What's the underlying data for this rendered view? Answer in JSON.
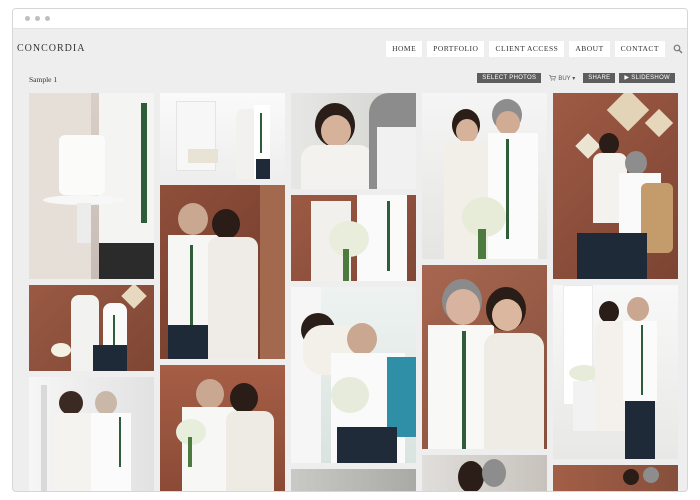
{
  "site": {
    "logo": "CONCORDIA"
  },
  "nav": {
    "items": [
      "HOME",
      "PORTFOLIO",
      "CLIENT ACCESS",
      "ABOUT",
      "CONTACT"
    ]
  },
  "album": {
    "title": "Sample 1"
  },
  "toolbar": {
    "select_photos": "SELECT PHOTOS",
    "buy": "BUY ▾",
    "share": "SHARE",
    "slideshow": "▶ SLIDESHOW"
  },
  "icons": {
    "search": "search-icon",
    "cart": "cart-icon"
  },
  "colors": {
    "button_bg": "#5e5e5e",
    "page_bg": "#eeeeee"
  }
}
